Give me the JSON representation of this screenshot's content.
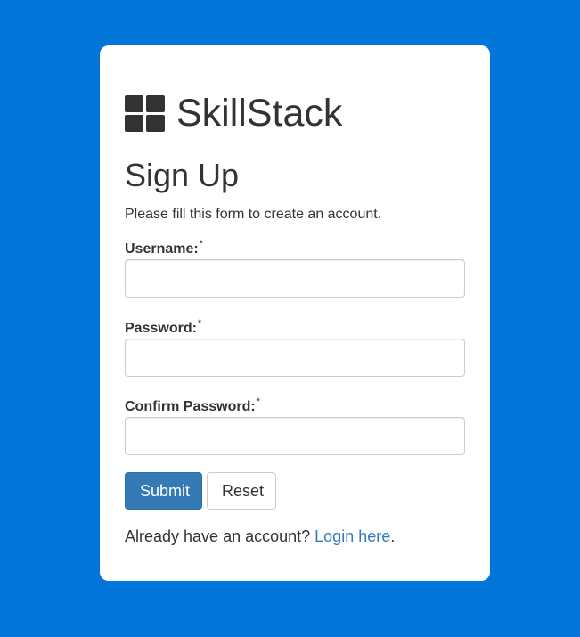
{
  "brand": {
    "name": "SkillStack",
    "icon": "grid-icon"
  },
  "form": {
    "title": "Sign Up",
    "subtitle": "Please fill this form to create an account.",
    "required_marker": "*",
    "fields": [
      {
        "label": "Username:",
        "value": "",
        "placeholder": ""
      },
      {
        "label": "Password:",
        "value": "",
        "placeholder": ""
      },
      {
        "label": "Confirm Password:",
        "value": "",
        "placeholder": ""
      }
    ],
    "submit_label": "Submit",
    "reset_label": "Reset",
    "footer_text": "Already have an account? ",
    "login_link_label": "Login here",
    "footer_end": "."
  },
  "colors": {
    "background": "#0275d8",
    "primary_button": "#337ab7",
    "link": "#337ab7"
  }
}
